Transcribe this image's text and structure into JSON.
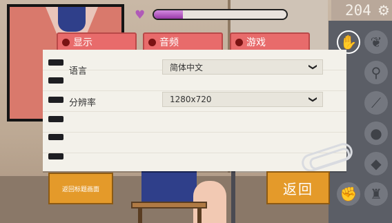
{
  "hud": {
    "counter": "204",
    "affection_level": 0.22,
    "heart_icon": "heart-icon",
    "settings_icon": "gear-icon"
  },
  "tabs": [
    {
      "label": "显示",
      "active": true
    },
    {
      "label": "音频",
      "active": false
    },
    {
      "label": "游戏",
      "active": false
    }
  ],
  "settings": {
    "language": {
      "label": "语言",
      "value": "简体中文"
    },
    "resolution": {
      "label": "分辨率",
      "value": "1280x720"
    }
  },
  "buttons": {
    "return_title": "返回标题画面",
    "back": "返回"
  },
  "tools": [
    {
      "name": "hand-icon",
      "glyph": "✋",
      "active": true
    },
    {
      "name": "leaf-icon",
      "glyph": "❦",
      "active": false
    },
    {
      "name": "ribbon-icon",
      "glyph": "⚲",
      "active": false
    },
    {
      "name": "wand-icon",
      "glyph": "⟋",
      "active": false
    },
    {
      "name": "bubble-icon",
      "glyph": "●",
      "active": false
    },
    {
      "name": "drop-icon",
      "glyph": "◆",
      "active": false
    },
    {
      "name": "spade-icon",
      "glyph": "♠",
      "active": false
    },
    {
      "name": "grab-icon",
      "glyph": "✊",
      "active": false
    },
    {
      "name": "bottle-icon",
      "glyph": "♜",
      "active": false
    }
  ],
  "colors": {
    "tab_active": "#e86b6b",
    "button_orange": "#e49a2a",
    "affection_fill": "#b05ab8"
  }
}
